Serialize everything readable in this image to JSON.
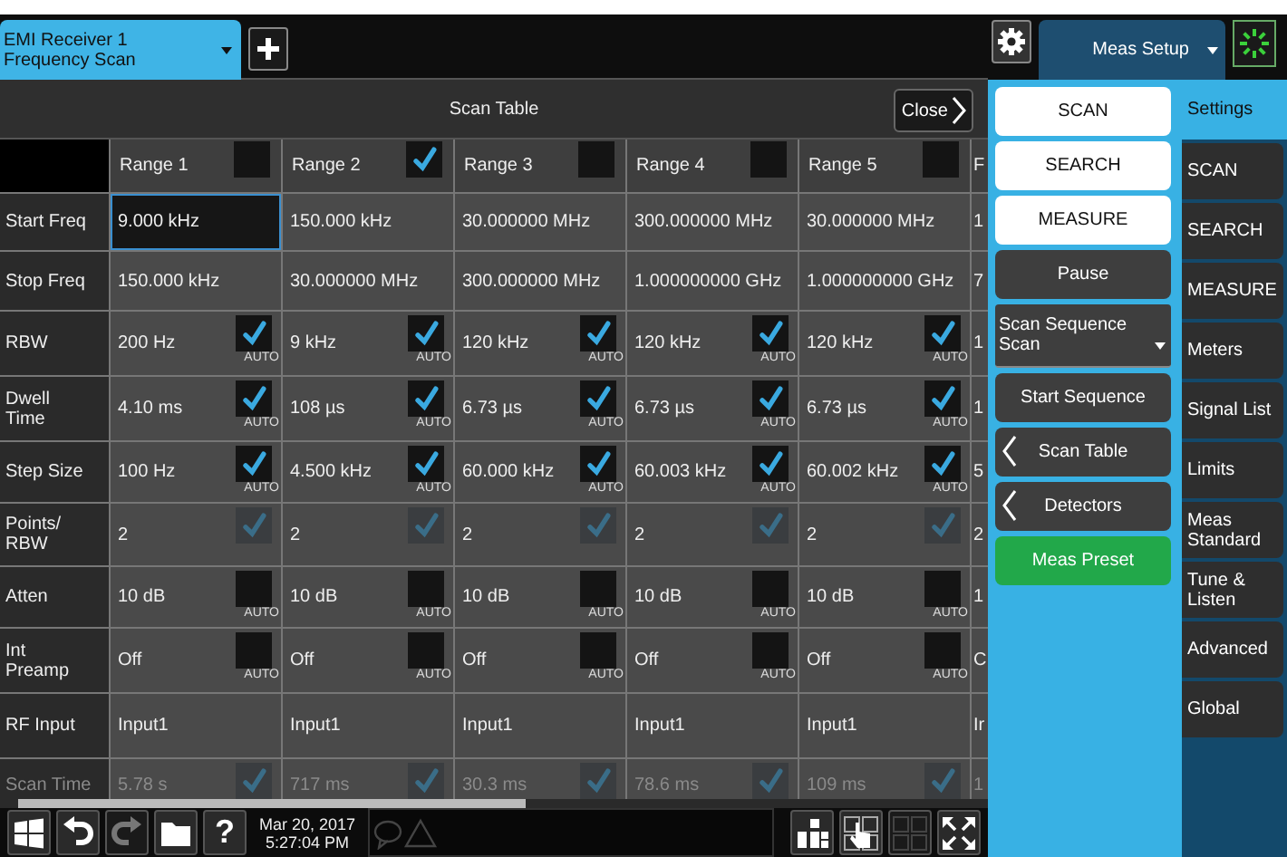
{
  "measurement_tab": {
    "line_1": "EMI Receiver 1",
    "line_2": "Frequency Scan"
  },
  "menu_tab": {
    "title": "Meas Setup"
  },
  "panel": {
    "title": "Scan Table",
    "close": "Close"
  },
  "table": {
    "columns": [
      {
        "label": "Range 1",
        "checked": false
      },
      {
        "label": "Range 2",
        "checked": true
      },
      {
        "label": "Range 3",
        "checked": false
      },
      {
        "label": "Range 4",
        "checked": false
      },
      {
        "label": "Range 5",
        "checked": false
      }
    ],
    "cut_header": "F",
    "rows": [
      {
        "label": "Start Freq",
        "kind": "plain",
        "disabled": false,
        "cut_cell": "1",
        "cells": [
          {
            "value": "9.000 kHz",
            "selected": true
          },
          {
            "value": "150.000 kHz",
            "selected": false
          },
          {
            "value": "30.000000 MHz",
            "selected": false
          },
          {
            "value": "300.000000 MHz",
            "selected": false
          },
          {
            "value": "30.000000 MHz",
            "selected": false
          }
        ]
      },
      {
        "label": "Stop Freq",
        "kind": "plain",
        "disabled": false,
        "cut_cell": "7",
        "cells": [
          {
            "value": "150.000 kHz"
          },
          {
            "value": "30.000000 MHz"
          },
          {
            "value": "300.000000 MHz"
          },
          {
            "value": "1.000000000 GHz"
          },
          {
            "value": "1.000000000 GHz"
          }
        ]
      },
      {
        "label": "RBW",
        "kind": "auto",
        "disabled": false,
        "cut_cell": "1",
        "cells": [
          {
            "value": "200 Hz",
            "checked": true,
            "auto_label": "AUTO"
          },
          {
            "value": "9 kHz",
            "checked": true,
            "auto_label": "AUTO"
          },
          {
            "value": "120 kHz",
            "checked": true,
            "auto_label": "AUTO"
          },
          {
            "value": "120 kHz",
            "checked": true,
            "auto_label": "AUTO"
          },
          {
            "value": "120 kHz",
            "checked": true,
            "auto_label": "AUTO"
          }
        ]
      },
      {
        "label": "Dwell\nTime",
        "kind": "auto",
        "disabled": false,
        "cut_cell": "1",
        "cells": [
          {
            "value": "4.10 ms",
            "checked": true,
            "auto_label": "AUTO"
          },
          {
            "value": "108 µs",
            "checked": true,
            "auto_label": "AUTO"
          },
          {
            "value": "6.73 µs",
            "checked": true,
            "auto_label": "AUTO"
          },
          {
            "value": "6.73 µs",
            "checked": true,
            "auto_label": "AUTO"
          },
          {
            "value": "6.73 µs",
            "checked": true,
            "auto_label": "AUTO"
          }
        ]
      },
      {
        "label": "Step Size",
        "kind": "auto",
        "disabled": false,
        "cut_cell": "5",
        "cells": [
          {
            "value": "100 Hz",
            "checked": true,
            "auto_label": "AUTO"
          },
          {
            "value": "4.500 kHz",
            "checked": true,
            "auto_label": "AUTO"
          },
          {
            "value": "60.000 kHz",
            "checked": true,
            "auto_label": "AUTO"
          },
          {
            "value": "60.003 kHz",
            "checked": true,
            "auto_label": "AUTO"
          },
          {
            "value": "60.002 kHz",
            "checked": true,
            "auto_label": "AUTO"
          }
        ]
      },
      {
        "label": "Points/\nRBW",
        "kind": "fixed",
        "disabled": false,
        "cut_cell": "2",
        "cells": [
          {
            "value": "2",
            "checked": true
          },
          {
            "value": "2",
            "checked": true
          },
          {
            "value": "2",
            "checked": true
          },
          {
            "value": "2",
            "checked": true
          },
          {
            "value": "2",
            "checked": true
          }
        ]
      },
      {
        "label": "Atten",
        "kind": "auto",
        "disabled": false,
        "cut_cell": "1",
        "cells": [
          {
            "value": "10 dB",
            "checked": false,
            "auto_label": "AUTO"
          },
          {
            "value": "10 dB",
            "checked": false,
            "auto_label": "AUTO"
          },
          {
            "value": "10 dB",
            "checked": false,
            "auto_label": "AUTO"
          },
          {
            "value": "10 dB",
            "checked": false,
            "auto_label": "AUTO"
          },
          {
            "value": "10 dB",
            "checked": false,
            "auto_label": "AUTO"
          }
        ]
      },
      {
        "label": "Int\nPreamp",
        "kind": "auto",
        "disabled": false,
        "cut_cell": "C",
        "cells": [
          {
            "value": "Off",
            "checked": false,
            "auto_label": "AUTO"
          },
          {
            "value": "Off",
            "checked": false,
            "auto_label": "AUTO"
          },
          {
            "value": "Off",
            "checked": false,
            "auto_label": "AUTO"
          },
          {
            "value": "Off",
            "checked": false,
            "auto_label": "AUTO"
          },
          {
            "value": "Off",
            "checked": false,
            "auto_label": "AUTO"
          }
        ]
      },
      {
        "label": "RF Input",
        "kind": "plain",
        "disabled": false,
        "cut_cell": "Ir",
        "cells": [
          {
            "value": "Input1"
          },
          {
            "value": "Input1"
          },
          {
            "value": "Input1"
          },
          {
            "value": "Input1"
          },
          {
            "value": "Input1"
          }
        ]
      },
      {
        "label": "Scan Time",
        "kind": "fixed",
        "disabled": true,
        "cut_cell": "1",
        "cells": [
          {
            "value": "5.78 s",
            "checked": true
          },
          {
            "value": "717 ms",
            "checked": true
          },
          {
            "value": "30.3 ms",
            "checked": true
          },
          {
            "value": "78.6 ms",
            "checked": true
          },
          {
            "value": "109 ms",
            "checked": true
          }
        ]
      }
    ]
  },
  "menu_buttons": [
    {
      "kind": "light",
      "label": "SCAN"
    },
    {
      "kind": "light",
      "label": "SEARCH"
    },
    {
      "kind": "light",
      "label": "MEASURE"
    },
    {
      "kind": "dark",
      "label": "Pause"
    },
    {
      "kind": "dropdown",
      "label": "Scan Sequence",
      "value": "Scan"
    },
    {
      "kind": "dark",
      "label": "Start Sequence"
    },
    {
      "kind": "back",
      "label": "Scan Table"
    },
    {
      "kind": "back",
      "label": "Detectors"
    },
    {
      "kind": "green",
      "label": "Meas Preset"
    }
  ],
  "side_tabs": [
    {
      "label": "Settings",
      "selected": true
    },
    {
      "label": "SCAN",
      "selected": false
    },
    {
      "label": "SEARCH",
      "selected": false
    },
    {
      "label": "MEASURE",
      "selected": false
    },
    {
      "label": "Meters",
      "selected": false
    },
    {
      "label": "Signal List",
      "selected": false
    },
    {
      "label": "Limits",
      "selected": false
    },
    {
      "label": "Meas Standard",
      "selected": false
    },
    {
      "label": "Tune & Listen",
      "selected": false
    },
    {
      "label": "Advanced",
      "selected": false
    },
    {
      "label": "Global",
      "selected": false
    }
  ],
  "taskbar": {
    "help": "?",
    "date": "Mar 20, 2017",
    "time": "5:27:04 PM",
    "redo_disabled": true
  }
}
